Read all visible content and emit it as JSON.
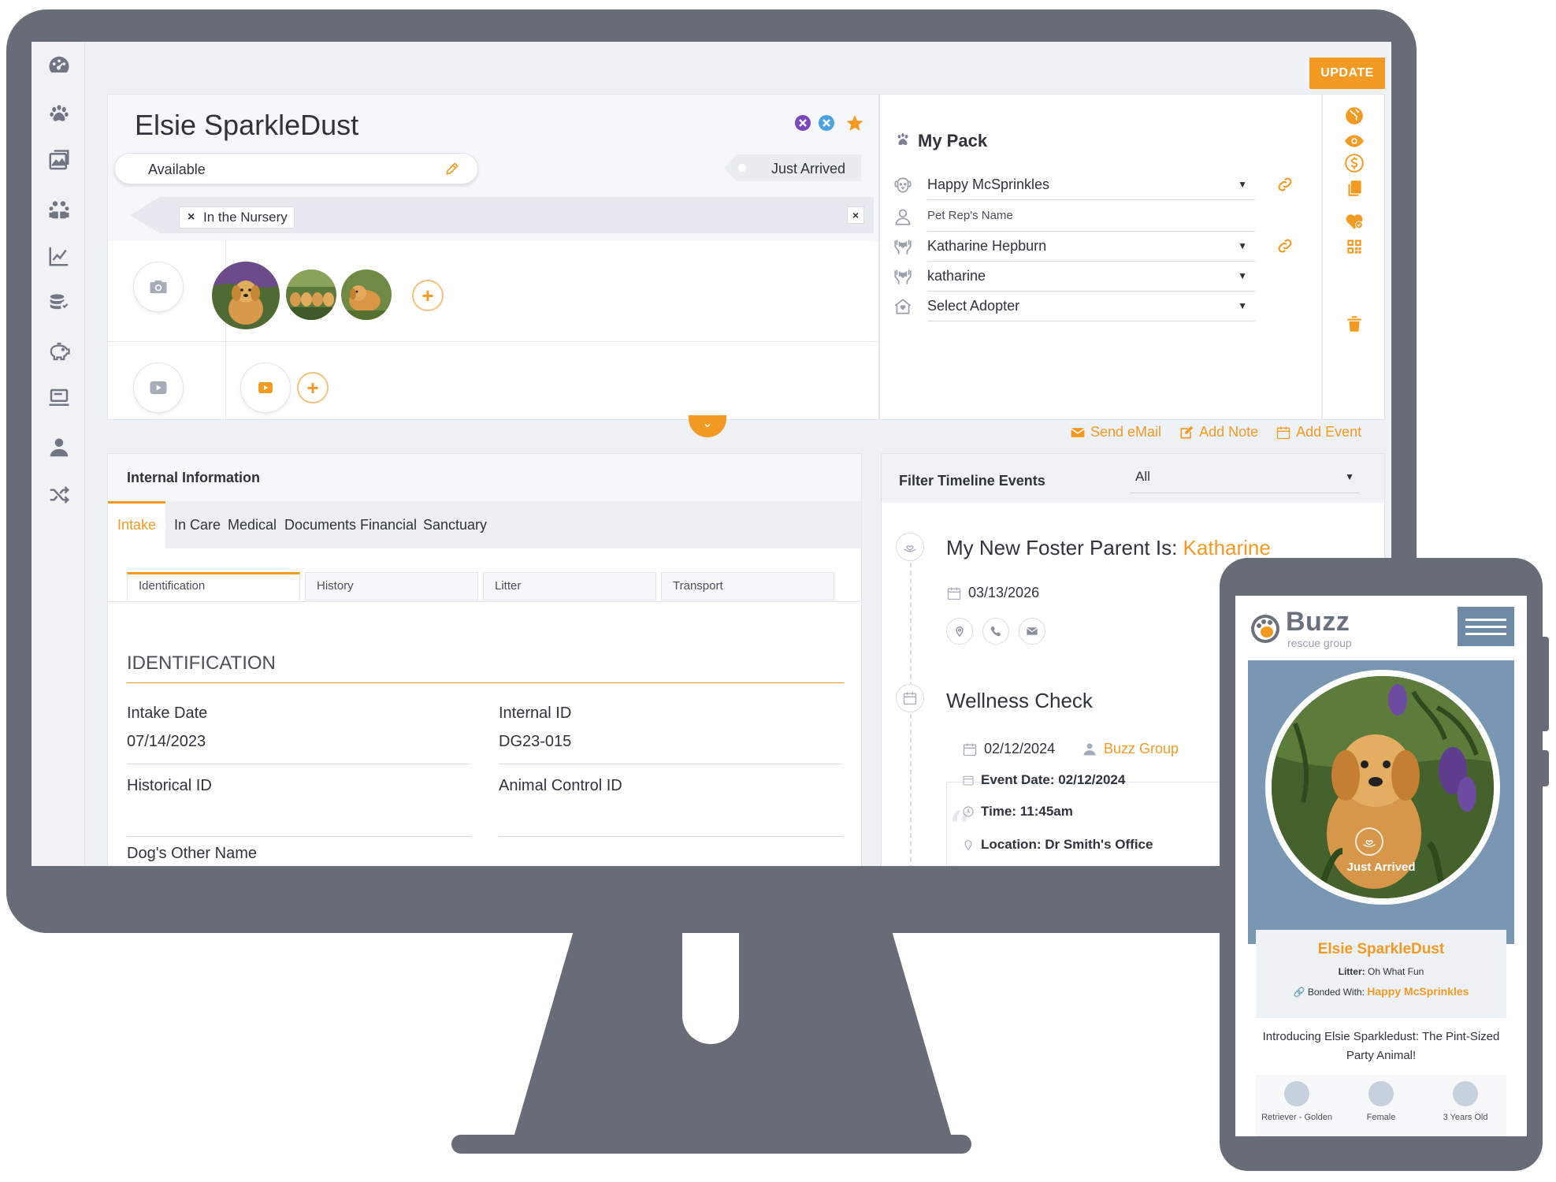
{
  "app": {
    "update_label": "UPDATE",
    "accent_color": "#f39a23",
    "frame_color": "#686c76"
  },
  "nav": {
    "items": [
      "dashboard-icon",
      "paw-icon",
      "gallery-icon",
      "people-icon",
      "chart-icon",
      "donations-icon",
      "piggy-bank-icon",
      "laptop-icon",
      "user-icon",
      "shuffle-icon"
    ]
  },
  "profile": {
    "name": "Elsie SparkleDust",
    "status": "Available",
    "arrival": "Just Arrived",
    "tag": "In the Nursery"
  },
  "pack": {
    "title": "My Pack",
    "rows": [
      {
        "value": "Happy McSprinkles",
        "icon": "dog-face-icon"
      },
      {
        "value": "Pet Rep's Name",
        "icon": "person-icon"
      },
      {
        "value": "Katharine Hepburn",
        "icon": "hands-icon"
      },
      {
        "value": "katharine",
        "icon": "hands-icon"
      },
      {
        "value": "Select Adopter",
        "icon": "home-icon"
      }
    ]
  },
  "actions": {
    "send_email": "Send eMail",
    "add_note": "Add Note",
    "add_event": "Add Event"
  },
  "internal": {
    "title": "Internal Information",
    "tabs": [
      "Intake",
      "In Care",
      "Medical",
      "Documents",
      "Financial",
      "Sanctuary"
    ],
    "active_tab": "Intake",
    "subtabs": [
      "Identification",
      "History",
      "Litter",
      "Transport"
    ],
    "section_title": "IDENTIFICATION",
    "fields": {
      "intake_date_label": "Intake Date",
      "intake_date": "07/14/2023",
      "internal_id_label": "Internal ID",
      "internal_id": "DG23-015",
      "historical_id_label": "Historical ID",
      "historical_id": "",
      "animal_control_label": "Animal Control ID",
      "animal_control": "",
      "other_name_label": "Dog's Other Name"
    }
  },
  "timeline": {
    "filter_label": "Filter Timeline Events",
    "filter_value": "All",
    "event1": {
      "title_prefix": "My New Foster Parent Is:",
      "title_highlight": "Katharine",
      "date": "03/13/2026"
    },
    "event2": {
      "title": "Wellness Check",
      "date": "02/12/2024",
      "group": "Buzz Group",
      "event_date": "Event Date: 02/12/2024",
      "time": "Time: 11:45am",
      "location": "Location: Dr Smith's Office"
    }
  },
  "mobile": {
    "brand": "Buzz",
    "brand_sub": "rescue group",
    "badge": "Just Arrived",
    "name": "Elsie SparkleDust",
    "litter_label": "Litter:",
    "litter_value": "Oh What Fun",
    "bonded_label": "Bonded With:",
    "bonded_value": "Happy McSprinkles",
    "description": "Introducing Elsie Sparkledust: The Pint-Sized Party Animal!",
    "attributes": [
      "Retriever - Golden",
      "Female",
      "3 Years Old"
    ]
  }
}
